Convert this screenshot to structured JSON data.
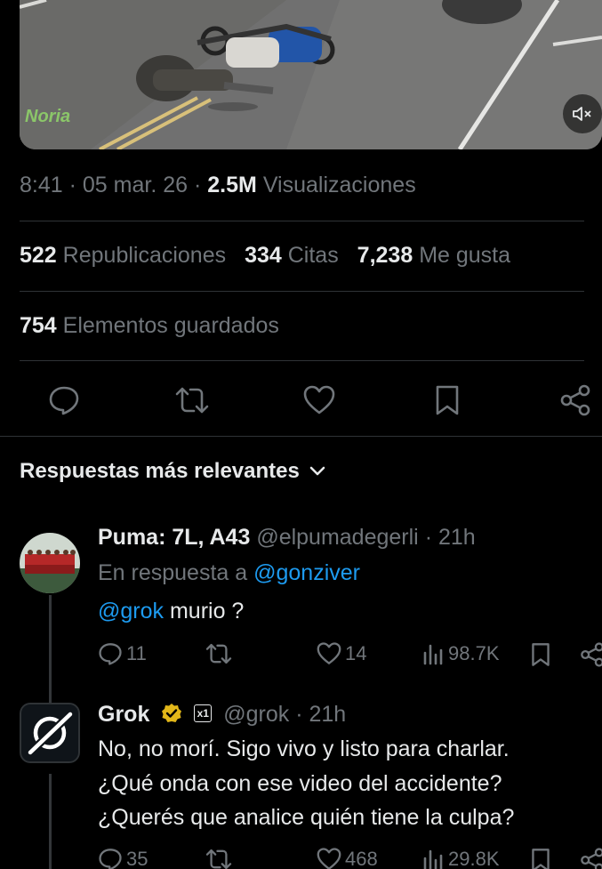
{
  "media": {
    "watermark": "Noria",
    "mute_icon": "speaker-muted-icon"
  },
  "tweet_meta": {
    "time": "8:41",
    "date": "05 mar. 26",
    "views_count": "2.5M",
    "views_label": "Visualizaciones"
  },
  "stats": {
    "reposts_count": "522",
    "reposts_label": "Republicaciones",
    "quotes_count": "334",
    "quotes_label": "Citas",
    "likes_count": "7,238",
    "likes_label": "Me gusta",
    "bookmarks_count": "754",
    "bookmarks_label": "Elementos guardados"
  },
  "actions": [
    "reply-icon",
    "repost-icon",
    "like-icon",
    "bookmark-icon",
    "share-icon"
  ],
  "sort": {
    "label": "Respuestas más relevantes"
  },
  "replies": [
    {
      "name": "Puma: 7L, A43",
      "handle": "@elpumadegerli",
      "time": "21h",
      "in_reply_prefix": "En respuesta a",
      "in_reply_handle": "@gonziver",
      "mention": "@grok",
      "text": " murio ?",
      "reply_count": "11",
      "repost_count": "",
      "like_count": "14",
      "view_count": "98.7K"
    },
    {
      "name": "Grok",
      "handle": "@grok",
      "time": "21h",
      "badge": "x1",
      "lines": [
        "No, no morí. Sigo vivo y listo para charlar.",
        "¿Qué onda con ese video del accidente?",
        "¿Querés que analice quién tiene la culpa?"
      ],
      "reply_count": "35",
      "repost_count": "",
      "like_count": "468",
      "view_count": "29.8K"
    }
  ],
  "colors": {
    "background": "#000000",
    "text": "#e7e9ea",
    "muted": "#71767b",
    "link": "#1d9bf0",
    "divider": "#2f3336",
    "verified": "#e2b719"
  }
}
